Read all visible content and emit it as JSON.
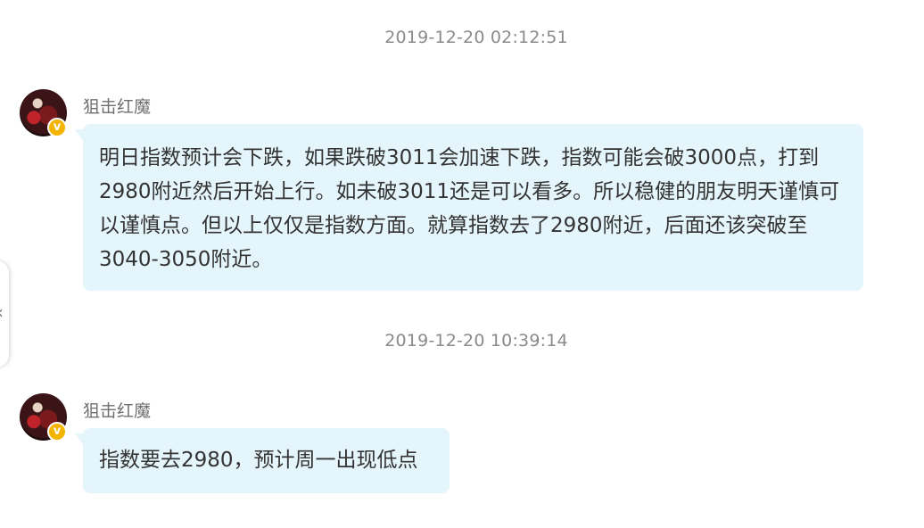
{
  "messages": [
    {
      "timestamp": "2019-12-20 02:12:51",
      "username": "狙击红魔",
      "badge": "v",
      "text": "明日指数预计会下跌，如果跌破3011会加速下跌，指数可能会破3000点，打到2980附近然后开始上行。如未破3011还是可以看多。所以稳健的朋友明天谨慎可以谨慎点。但以上仅仅是指数方面。就算指数去了2980附近，后面还该突破至3040-3050附近。"
    },
    {
      "timestamp": "2019-12-20 10:39:14",
      "username": "狙击红魔",
      "badge": "v",
      "text": "指数要去2980，预计周一出现低点"
    }
  ],
  "side_handle": {
    "icon": "chevron-left-icon",
    "glyph": "‹"
  },
  "colors": {
    "bubble_bg": "#e5f5fc",
    "badge": "#f5b400",
    "timestamp_text": "#8a8a8a"
  }
}
